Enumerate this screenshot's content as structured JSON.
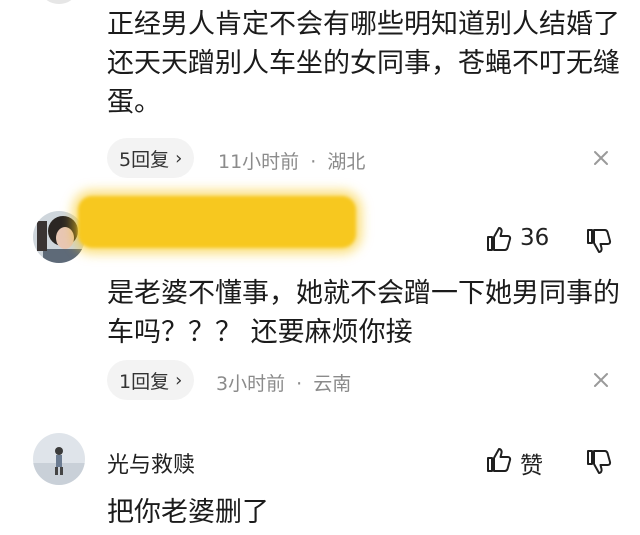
{
  "comments": [
    {
      "content_lines": [
        "正经男人肯定不会有哪些明知道别人结婚了",
        "还天天蹭别人车坐的女同事，苍蝇不叮无缝",
        "蛋。"
      ],
      "replies_label": "5回复",
      "time": "11小时前",
      "location": "湖北",
      "dot": "·"
    },
    {
      "username": "",
      "like_count": "36",
      "content_lines": [
        "是老婆不懂事，她就不会蹭一下她男同事的",
        "车吗？？？ 还要麻烦你接"
      ],
      "replies_label": "1回复",
      "time": "3小时前",
      "location": "云南",
      "dot": "·"
    },
    {
      "username": "光与救赎",
      "like_label": "赞",
      "content_lines": [
        "把你老婆删了"
      ]
    }
  ],
  "icons": {
    "like": "thumbs-up-icon",
    "dislike": "thumbs-down-icon",
    "close": "close-icon",
    "chevron": "chevron-right-icon"
  },
  "colors": {
    "redaction": "#f7c81f",
    "meta_text": "#8b8b8b",
    "pill_bg": "#f3f3f3"
  }
}
